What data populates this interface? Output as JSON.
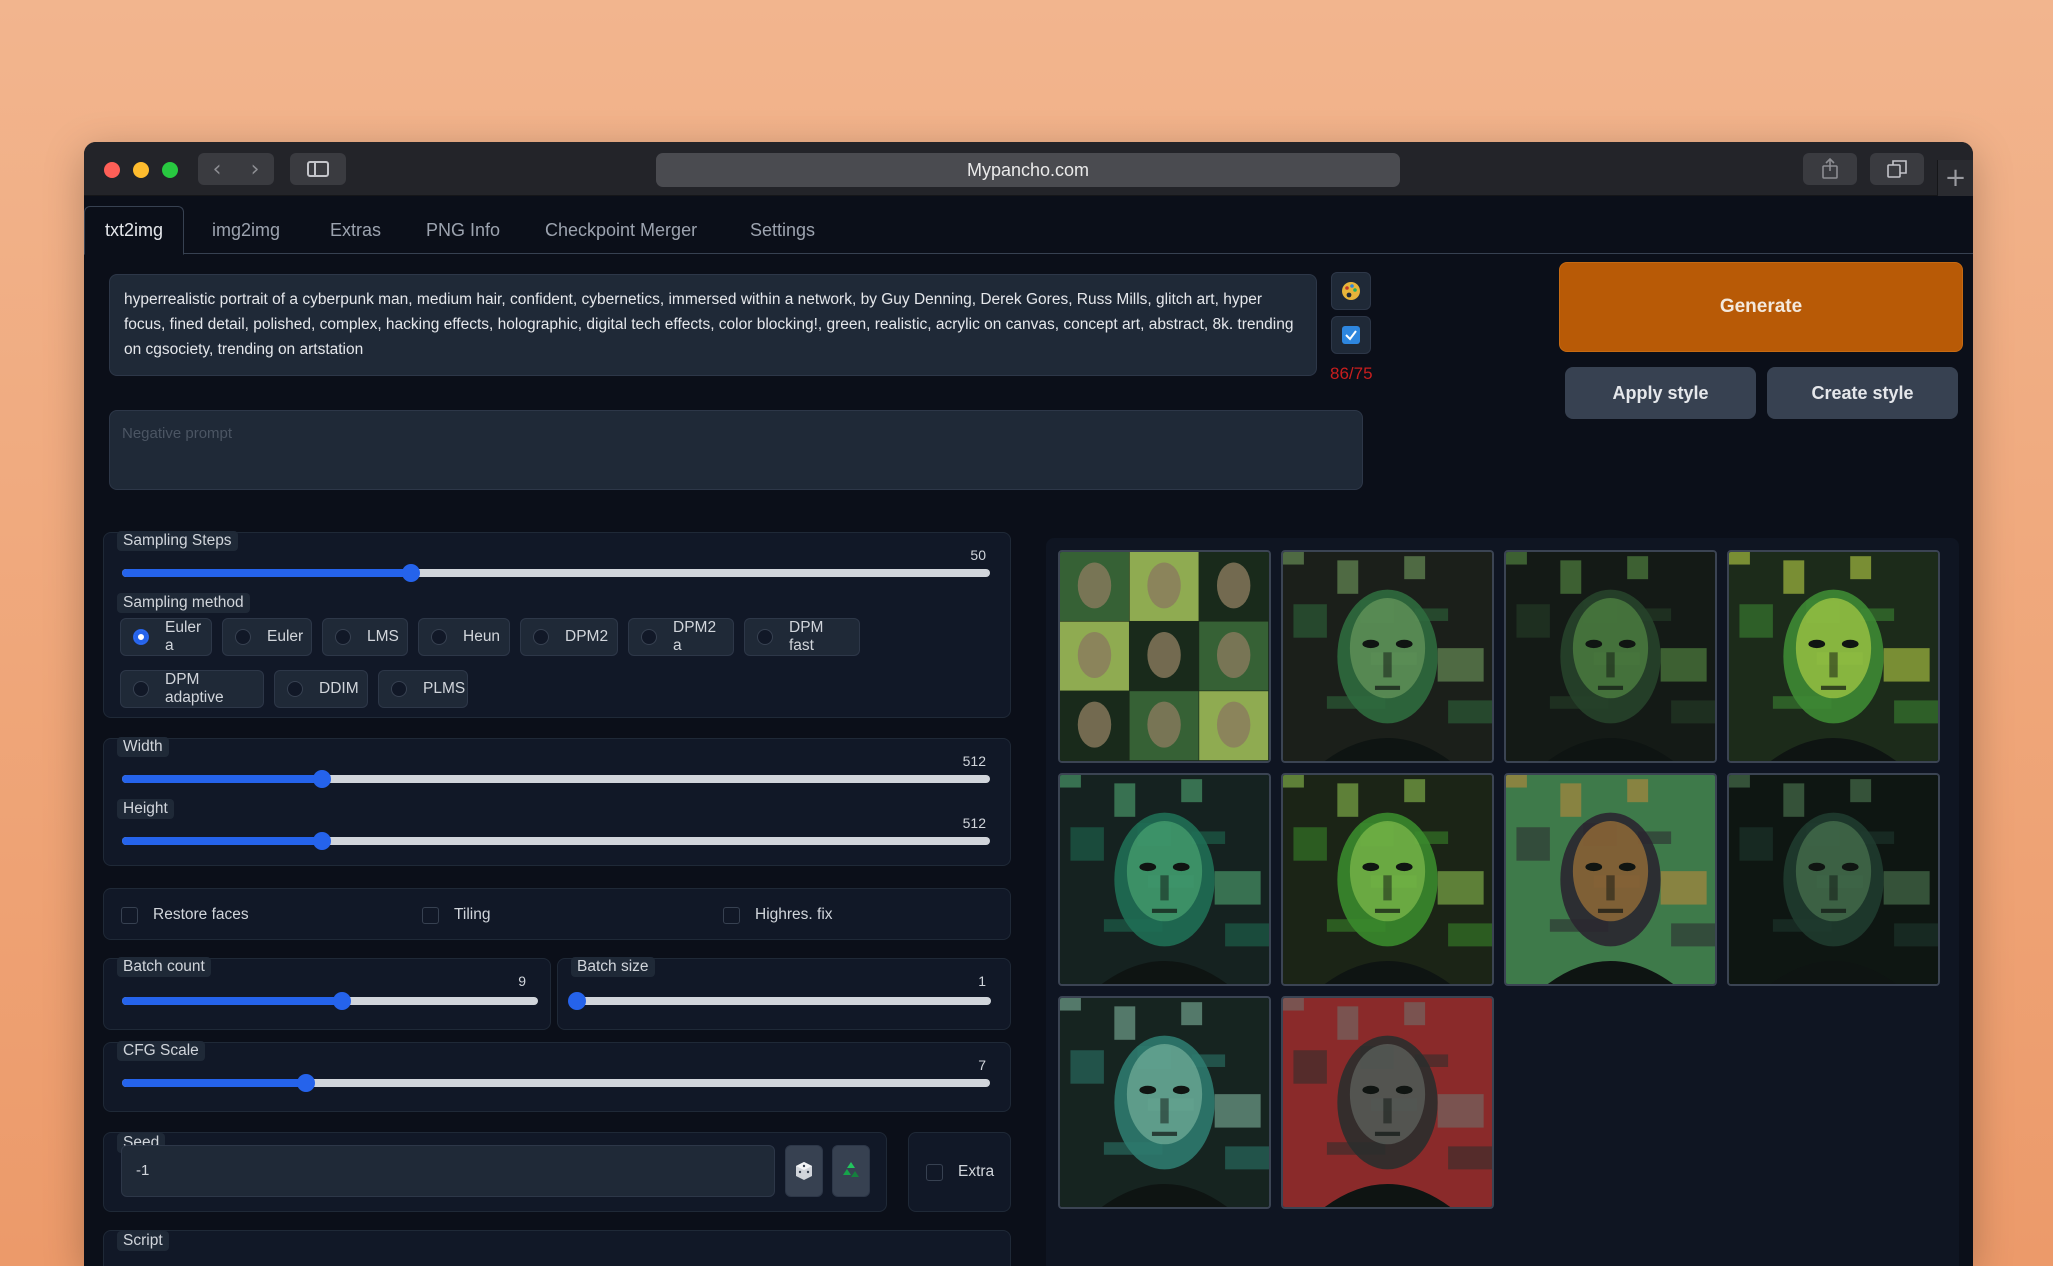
{
  "browser": {
    "url": "Mypancho.com"
  },
  "tabs": [
    "txt2img",
    "img2img",
    "Extras",
    "PNG Info",
    "Checkpoint Merger",
    "Settings"
  ],
  "prompt": {
    "text": "hyperrealistic portrait of a cyberpunk man, medium hair, confident, cybernetics, immersed within a network, by Guy Denning, Derek Gores, Russ Mills, glitch art, hyper focus, fined detail, polished, complex, hacking effects, holographic, digital tech effects, color blocking!, green, realistic, acrylic on canvas, concept art, abstract, 8k. trending on cgsociety, trending on artstation",
    "token_count": "86/75",
    "negative_placeholder": "Negative prompt"
  },
  "actions": {
    "generate": "Generate",
    "apply_style": "Apply style",
    "create_style": "Create style"
  },
  "settings": {
    "sampling_steps": {
      "label": "Sampling Steps",
      "value": "50",
      "fraction": 0.333
    },
    "sampling_method": {
      "label": "Sampling method",
      "options": [
        "Euler a",
        "Euler",
        "LMS",
        "Heun",
        "DPM2",
        "DPM2 a",
        "DPM fast",
        "DPM adaptive",
        "DDIM",
        "PLMS"
      ],
      "selected": "Euler a"
    },
    "width": {
      "label": "Width",
      "value": "512",
      "fraction": 0.23
    },
    "height": {
      "label": "Height",
      "value": "512",
      "fraction": 0.23
    },
    "checkboxes": [
      "Restore faces",
      "Tiling",
      "Highres. fix"
    ],
    "batch_count": {
      "label": "Batch count",
      "value": "9",
      "fraction": 0.53
    },
    "batch_size": {
      "label": "Batch size",
      "value": "1",
      "fraction": 0.0
    },
    "cfg_scale": {
      "label": "CFG Scale",
      "value": "7",
      "fraction": 0.212
    },
    "seed": {
      "label": "Seed",
      "value": "-1"
    },
    "extra_label": "Extra",
    "script_label": "Script"
  },
  "gallery": {
    "images": [
      {
        "palette": [
          "#3c6b3a",
          "#a5c25a",
          "#1a2a1b"
        ]
      },
      {
        "palette": [
          "#2f6a3e",
          "#7aa866",
          "#1b1f1a"
        ]
      },
      {
        "palette": [
          "#26422a",
          "#5e9a4a",
          "#141a16"
        ]
      },
      {
        "palette": [
          "#3e8a34",
          "#c7e04a",
          "#1c2b1a"
        ]
      },
      {
        "palette": [
          "#1f6e54",
          "#55b37a",
          "#152220"
        ]
      },
      {
        "palette": [
          "#3a8a2c",
          "#95cc55",
          "#1b2416"
        ]
      },
      {
        "palette": [
          "#2a2630",
          "#c48a3a",
          "#3e7a4a"
        ]
      },
      {
        "palette": [
          "#1f3b2f",
          "#55855a",
          "#0e1612"
        ]
      },
      {
        "palette": [
          "#2e7a6e",
          "#88c0a8",
          "#162420"
        ]
      },
      {
        "palette": [
          "#2a2d2c",
          "#6e7470",
          "#8a2a2a"
        ]
      }
    ]
  }
}
